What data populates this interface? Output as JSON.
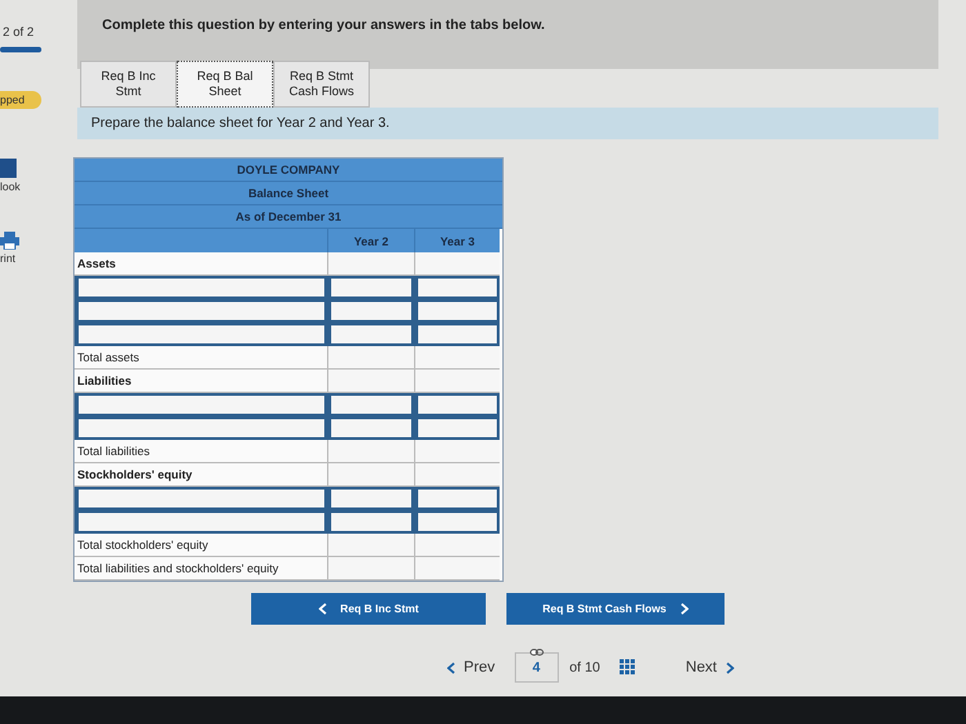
{
  "sidebar": {
    "progress": {
      "text": "2 of 2",
      "level": 1
    },
    "badge": "pped",
    "tools": [
      {
        "kind": "book",
        "label": "look"
      },
      {
        "kind": "print",
        "label": "rint"
      }
    ]
  },
  "instruction": "Complete this question by entering your answers in the tabs below.",
  "tabs": [
    {
      "label": "Req B Inc Stmt",
      "selected": false
    },
    {
      "label": "Req B Bal Sheet",
      "selected": true
    },
    {
      "label": "Req B Stmt Cash Flows",
      "selected": false
    }
  ],
  "prompt": "Prepare the balance sheet for Year 2 and Year 3.",
  "table": {
    "titles": [
      "DOYLE COMPANY",
      "Balance Sheet",
      "As of December 31"
    ],
    "columns": [
      "Year 2",
      "Year 3"
    ],
    "rows": [
      {
        "kind": "heading",
        "label": "Assets"
      },
      {
        "kind": "input"
      },
      {
        "kind": "input"
      },
      {
        "kind": "input"
      },
      {
        "kind": "total",
        "label": "Total assets"
      },
      {
        "kind": "heading",
        "label": "Liabilities"
      },
      {
        "kind": "input"
      },
      {
        "kind": "input"
      },
      {
        "kind": "total",
        "label": "Total liabilities"
      },
      {
        "kind": "heading",
        "label": "Stockholders' equity"
      },
      {
        "kind": "input"
      },
      {
        "kind": "input"
      },
      {
        "kind": "total",
        "label": "Total stockholders' equity"
      },
      {
        "kind": "total",
        "label": "Total liabilities and stockholders' equity"
      }
    ]
  },
  "nav_buttons": [
    {
      "label": "Req B Inc Stmt",
      "kind": "prev"
    },
    {
      "label": "Req B Stmt Cash Flows",
      "kind": "next"
    }
  ],
  "pager": {
    "prev": "Prev",
    "page": "4",
    "total": "of 10",
    "next": "Next"
  }
}
